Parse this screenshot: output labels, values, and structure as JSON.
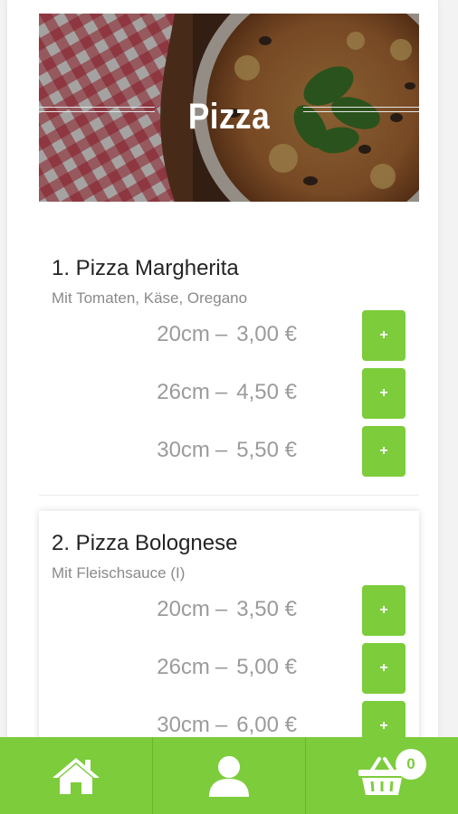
{
  "category": {
    "title": "Pizza"
  },
  "items": [
    {
      "title": "1. Pizza Margherita",
      "description": "Mit Tomaten, Käse, Oregano",
      "prices": [
        {
          "size": "20cm",
          "dash": "–",
          "price": "3,00 €",
          "button": "+"
        },
        {
          "size": "26cm",
          "dash": "–",
          "price": "4,50 €",
          "button": "+"
        },
        {
          "size": "30cm",
          "dash": "–",
          "price": "5,50 €",
          "button": "+"
        }
      ]
    },
    {
      "title": "2. Pizza Bolognese",
      "description": "Mit Fleischsauce (I)",
      "prices": [
        {
          "size": "20cm",
          "dash": "–",
          "price": "3,50 €",
          "button": "+"
        },
        {
          "size": "26cm",
          "dash": "–",
          "price": "5,00 €",
          "button": "+"
        },
        {
          "size": "30cm",
          "dash": "–",
          "price": "6,00 €",
          "button": "+"
        }
      ]
    }
  ],
  "bottom_nav": {
    "home_icon": "home-icon",
    "profile_icon": "user-icon",
    "cart_icon": "basket-icon",
    "cart_count": "0"
  },
  "colors": {
    "accent": "#7ccc3b",
    "price_text": "#9b9b9b",
    "title_text": "#242424",
    "desc_text": "#8a8a8a"
  }
}
